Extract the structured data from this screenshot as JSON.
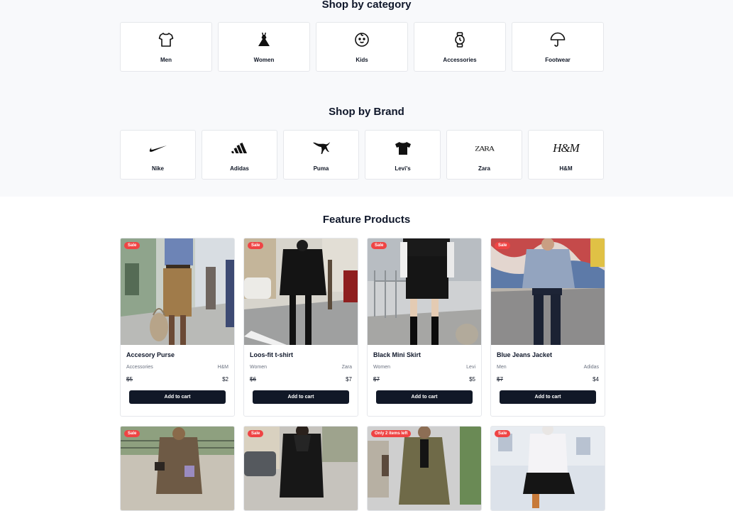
{
  "sections": {
    "category_title": "Shop by category",
    "brand_title": "Shop by Brand",
    "featured_title": "Feature Products"
  },
  "categories": [
    {
      "label": "Men",
      "icon": "tshirt-icon"
    },
    {
      "label": "Women",
      "icon": "dress-icon"
    },
    {
      "label": "Kids",
      "icon": "baby-face-icon"
    },
    {
      "label": "Accessories",
      "icon": "watch-icon"
    },
    {
      "label": "Footwear",
      "icon": "umbrella-icon"
    }
  ],
  "brands": [
    {
      "label": "Nike",
      "icon": "nike-logo"
    },
    {
      "label": "Adidas",
      "icon": "adidas-logo"
    },
    {
      "label": "Puma",
      "icon": "puma-logo"
    },
    {
      "label": "Levi's",
      "icon": "levis-logo"
    },
    {
      "label": "Zara",
      "icon": "zara-logo",
      "logo_text": "ZARA"
    },
    {
      "label": "H&M",
      "icon": "hm-logo",
      "logo_text": "H&M"
    }
  ],
  "products": [
    {
      "badge": "Sale",
      "name": "Accesory Purse",
      "category": "Accessories",
      "brand": "H&M",
      "old_price": "$5",
      "price": "$2",
      "button": "Add to cart"
    },
    {
      "badge": "Sale",
      "name": "Loos-fit t-shirt",
      "category": "Women",
      "brand": "Zara",
      "old_price": "$6",
      "price": "$7",
      "button": "Add to cart"
    },
    {
      "badge": "Sale",
      "name": "Black Mini Skirt",
      "category": "Women",
      "brand": "Levi",
      "old_price": "$7",
      "price": "$5",
      "button": "Add to cart"
    },
    {
      "badge": "Sale",
      "name": "Blue Jeans Jacket",
      "category": "Men",
      "brand": "Adidas",
      "old_price": "$7",
      "price": "$4",
      "button": "Add to cart"
    },
    {
      "badge": "Sale"
    },
    {
      "badge": "Sale"
    },
    {
      "badge": "Only 2 items left"
    },
    {
      "badge": "Sale"
    }
  ],
  "colors": {
    "accent_dark": "#111827",
    "sale_badge": "#ef4444",
    "band_bg": "#f8f9fb"
  }
}
